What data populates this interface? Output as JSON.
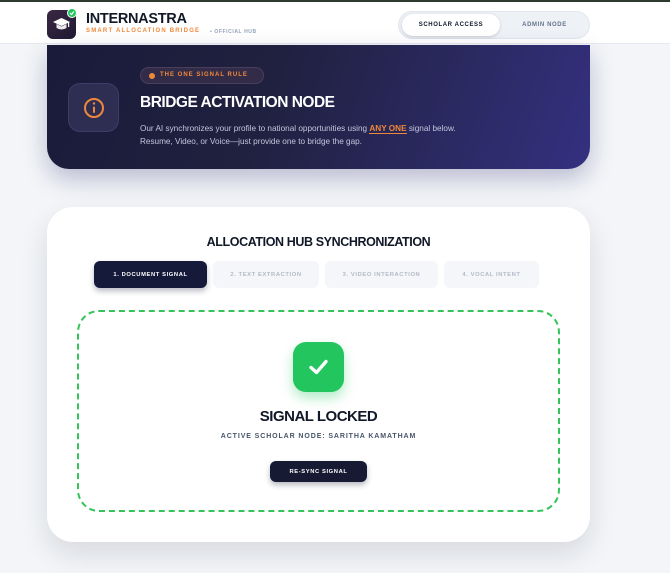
{
  "header": {
    "brand_title": "INTERNASTRA",
    "brand_subtitle": "SMART ALLOCATION BRIDGE",
    "brand_tag": "• OFFICIAL HUB",
    "toggle": {
      "options": [
        "SCHOLAR ACCESS",
        "ADMIN NODE"
      ],
      "selected": "SCHOLAR ACCESS"
    }
  },
  "hero": {
    "pill": "THE ONE SIGNAL RULE",
    "title": "BRIDGE ACTIVATION NODE",
    "desc_before": "Our AI synchronizes your profile to national opportunities using ",
    "desc_highlight": "ANY ONE",
    "desc_after": " signal below. Resume, Video, or Voice—just provide one to bridge the gap.",
    "icon": "info-icon"
  },
  "hub": {
    "title": "ALLOCATION HUB SYNCHRONIZATION",
    "steps": [
      {
        "label": "1. DOCUMENT SIGNAL",
        "active": true
      },
      {
        "label": "2. TEXT EXTRACTION",
        "active": false
      },
      {
        "label": "3. VIDEO INTERACTION",
        "active": false
      },
      {
        "label": "4. VOCAL INTENT",
        "active": false
      }
    ],
    "status_title": "SIGNAL LOCKED",
    "status_subtitle": "ACTIVE SCHOLAR NODE: SARITHA KAMATHAM",
    "resync_label": "RE-SYNC SIGNAL",
    "status_icon": "check-icon"
  },
  "colors": {
    "accent": "#f0883c",
    "success": "#22c55e",
    "navy": "#161a3a"
  }
}
